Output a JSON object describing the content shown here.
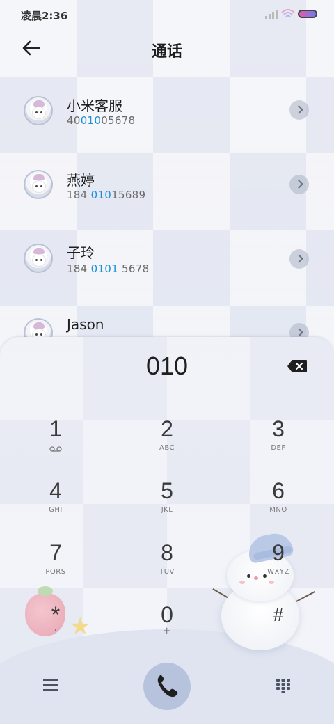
{
  "status_bar": {
    "time": "凌晨2:36"
  },
  "header": {
    "title": "通话"
  },
  "contacts": [
    {
      "name": "小米客服",
      "num_pre": "40",
      "num_match": "010",
      "num_post": "05678"
    },
    {
      "name": "燕婷",
      "num_pre": "184 ",
      "num_match": "010",
      "num_post": "15689"
    },
    {
      "name": "子玲",
      "num_pre": "184 ",
      "num_match": "0101",
      "num_post": " 5678"
    },
    {
      "name": "Jason",
      "num_pre": "",
      "num_match": "",
      "num_post": ""
    }
  ],
  "dialer": {
    "input": "010",
    "keys": [
      {
        "digit": "1",
        "letters": ""
      },
      {
        "digit": "2",
        "letters": "ABC"
      },
      {
        "digit": "3",
        "letters": "DEF"
      },
      {
        "digit": "4",
        "letters": "GHI"
      },
      {
        "digit": "5",
        "letters": "JKL"
      },
      {
        "digit": "6",
        "letters": "MNO"
      },
      {
        "digit": "7",
        "letters": "PQRS"
      },
      {
        "digit": "8",
        "letters": "TUV"
      },
      {
        "digit": "9",
        "letters": "WXYZ"
      },
      {
        "digit": "*",
        "letters": ","
      },
      {
        "digit": "0",
        "letters": "+"
      },
      {
        "digit": "#",
        "letters": ""
      }
    ]
  },
  "colors": {
    "match_highlight": "#1a8fd8",
    "call_button": "#b7c3dc"
  },
  "icons": [
    "back-arrow-icon",
    "chevron-right-icon",
    "backspace-icon",
    "voicemail-icon",
    "menu-icon",
    "phone-icon",
    "dialpad-icon",
    "signal-icon",
    "wifi-icon",
    "battery-icon"
  ]
}
